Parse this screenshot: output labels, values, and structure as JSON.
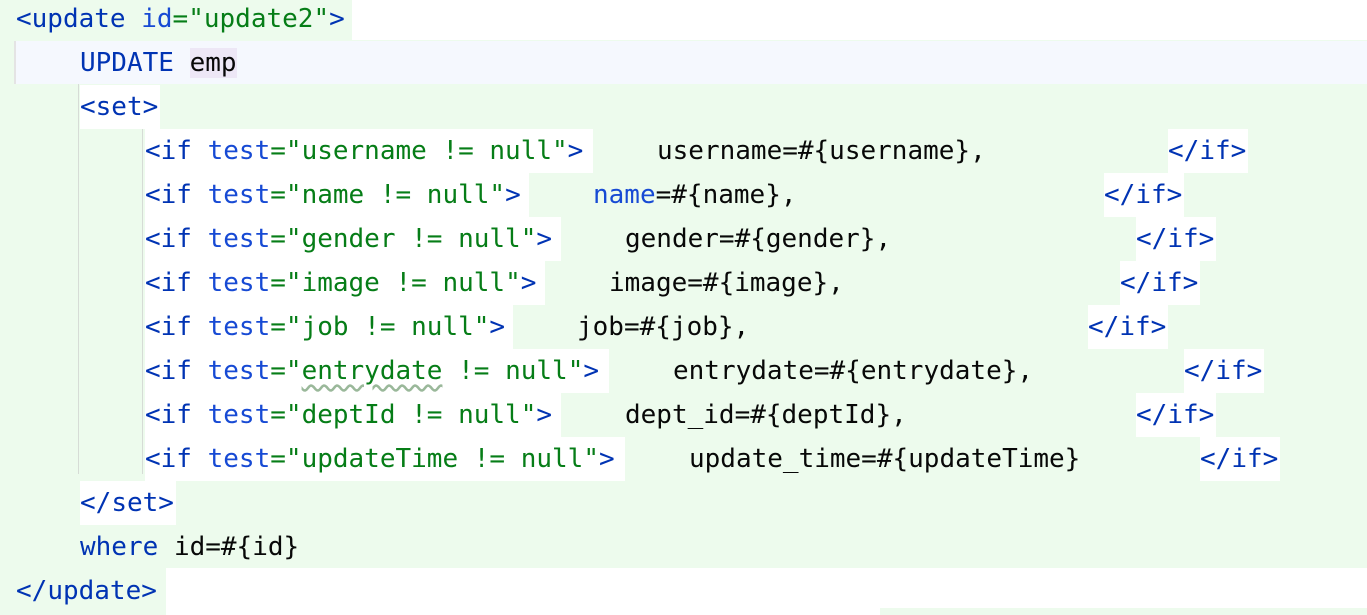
{
  "editor": {
    "open_tag": {
      "name": "update",
      "attr": "id",
      "value": "update2"
    },
    "update_line": {
      "keyword": "UPDATE",
      "table": "emp"
    },
    "set_open": "set",
    "if_rows": [
      {
        "test": "username != null",
        "body": "username=#{username},",
        "close": "if"
      },
      {
        "test": "name != null",
        "body_kw": "name",
        "body_rest": "=#{name},",
        "close": "if"
      },
      {
        "test": "gender != null",
        "body": "gender=#{gender},",
        "close": "if"
      },
      {
        "test": "image != null",
        "body": "image=#{image},",
        "close": "if"
      },
      {
        "test": "job != null",
        "body": "job=#{job},",
        "close": "if"
      },
      {
        "test_word": "entrydate",
        "test_rest": " != null",
        "body": "entrydate=#{entrydate},",
        "close": "if"
      },
      {
        "test": "deptId != null",
        "body": "dept_id=#{deptId},",
        "close": "if"
      },
      {
        "test": "updateTime != null",
        "body": "update_time=#{updateTime}",
        "close": "if"
      }
    ],
    "set_close": "set",
    "where_line": {
      "keyword": "where",
      "rest": "id=#{id}"
    },
    "close_tag": "update"
  },
  "colors": {
    "background_changed": "#edfbed",
    "tag": "#0033b3",
    "attribute": "#174ad4",
    "string": "#067d17",
    "text": "#080808"
  }
}
